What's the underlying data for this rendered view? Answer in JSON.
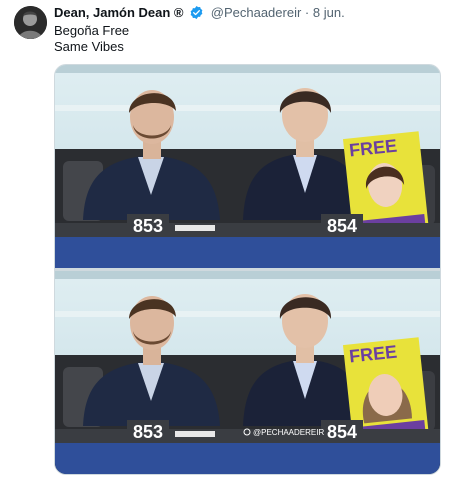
{
  "tweet": {
    "display_name": "Dean, Jamón Dean ®",
    "handle": "@Pechaadereir",
    "separator": "·",
    "date": "8 jun.",
    "text_line1": "Begoña Free",
    "text_line2": "Same Vibes"
  },
  "images": {
    "top": {
      "seat_left": "853",
      "seat_right": "854",
      "sign_text": "FREE"
    },
    "bottom": {
      "seat_left": "853",
      "seat_right": "854",
      "sign_text": "FREE",
      "watermark": "@PECHAADEREIR"
    }
  },
  "colors": {
    "verified": "#1d9bf0",
    "sign": "#e8e23a",
    "sign_purple": "#6b3fa0",
    "bench_blue": "#2f4f9a"
  },
  "icons": {
    "verified": "verified-badge-icon",
    "avatar": "avatar"
  }
}
